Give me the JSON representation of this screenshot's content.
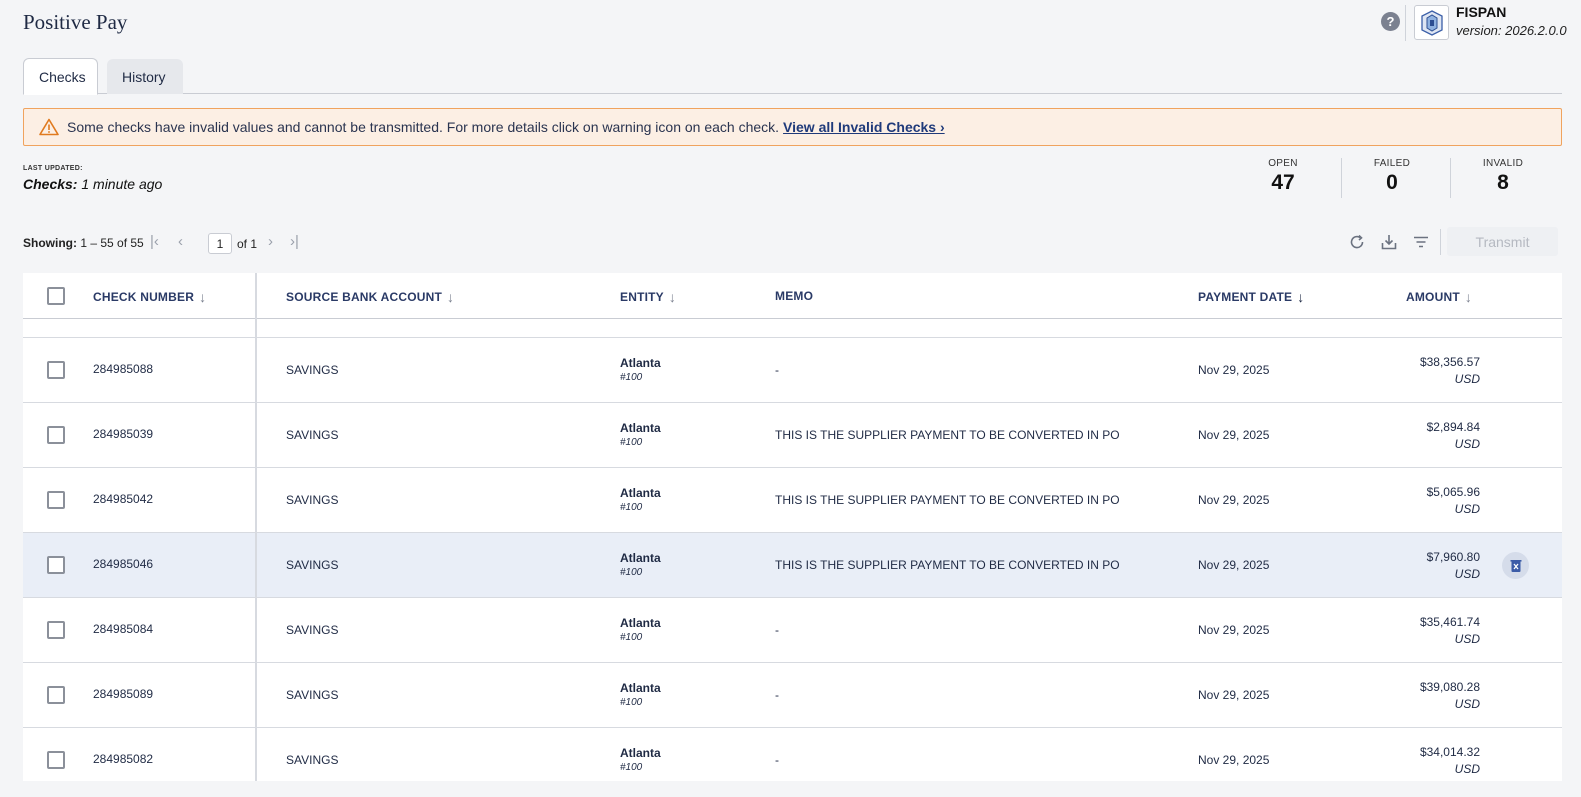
{
  "app": {
    "title": "Positive Pay"
  },
  "brand": {
    "name": "FISPAN",
    "version": "version: 2026.2.0.0"
  },
  "tabs": [
    {
      "label": "Checks",
      "active": true
    },
    {
      "label": "History",
      "active": false
    }
  ],
  "alert": {
    "message": "Some checks have invalid values and cannot be transmitted. For more details click on warning icon on each check.",
    "link": "View all Invalid Checks ›"
  },
  "status": {
    "last_updated_label": "LAST UPDATED:",
    "checks_label": "Checks:",
    "checks_value": "1 minute ago"
  },
  "stats": [
    {
      "label": "OPEN",
      "value": "47"
    },
    {
      "label": "FAILED",
      "value": "0"
    },
    {
      "label": "INVALID",
      "value": "8"
    }
  ],
  "pagination": {
    "showing_label": "Showing:",
    "range": "1 – 55 of 55",
    "page": "1",
    "of_text": "of 1"
  },
  "toolbar": {
    "transmit_label": "Transmit"
  },
  "table": {
    "columns": [
      "CHECK NUMBER",
      "SOURCE BANK ACCOUNT",
      "ENTITY",
      "MEMO",
      "PAYMENT DATE",
      "AMOUNT"
    ],
    "rows": [
      {
        "check_number": "284985088",
        "account": "SAVINGS",
        "entity": "Atlanta",
        "entity_id": "#100",
        "memo": "-",
        "date": "Nov 29, 2025",
        "amount": "$38,356.57",
        "currency": "USD"
      },
      {
        "check_number": "284985039",
        "account": "SAVINGS",
        "entity": "Atlanta",
        "entity_id": "#100",
        "memo": "THIS IS THE SUPPLIER PAYMENT TO BE CONVERTED IN PO",
        "date": "Nov 29, 2025",
        "amount": "$2,894.84",
        "currency": "USD"
      },
      {
        "check_number": "284985042",
        "account": "SAVINGS",
        "entity": "Atlanta",
        "entity_id": "#100",
        "memo": "THIS IS THE SUPPLIER PAYMENT TO BE CONVERTED IN PO",
        "date": "Nov 29, 2025",
        "amount": "$5,065.96",
        "currency": "USD"
      },
      {
        "check_number": "284985046",
        "account": "SAVINGS",
        "entity": "Atlanta",
        "entity_id": "#100",
        "memo": "THIS IS THE SUPPLIER PAYMENT TO BE CONVERTED IN PO",
        "date": "Nov 29, 2025",
        "amount": "$7,960.80",
        "currency": "USD"
      },
      {
        "check_number": "284985084",
        "account": "SAVINGS",
        "entity": "Atlanta",
        "entity_id": "#100",
        "memo": "-",
        "date": "Nov 29, 2025",
        "amount": "$35,461.74",
        "currency": "USD"
      },
      {
        "check_number": "284985089",
        "account": "SAVINGS",
        "entity": "Atlanta",
        "entity_id": "#100",
        "memo": "-",
        "date": "Nov 29, 2025",
        "amount": "$39,080.28",
        "currency": "USD"
      },
      {
        "check_number": "284985082",
        "account": "SAVINGS",
        "entity": "Atlanta",
        "entity_id": "#100",
        "memo": "-",
        "date": "Nov 29, 2025",
        "amount": "$34,014.32",
        "currency": "USD"
      }
    ]
  },
  "colors": {
    "accent": "#1f2a44",
    "alert_bg": "#fcefe4",
    "alert_border": "#f0a35e",
    "row_highlight": "#e9eef7"
  }
}
